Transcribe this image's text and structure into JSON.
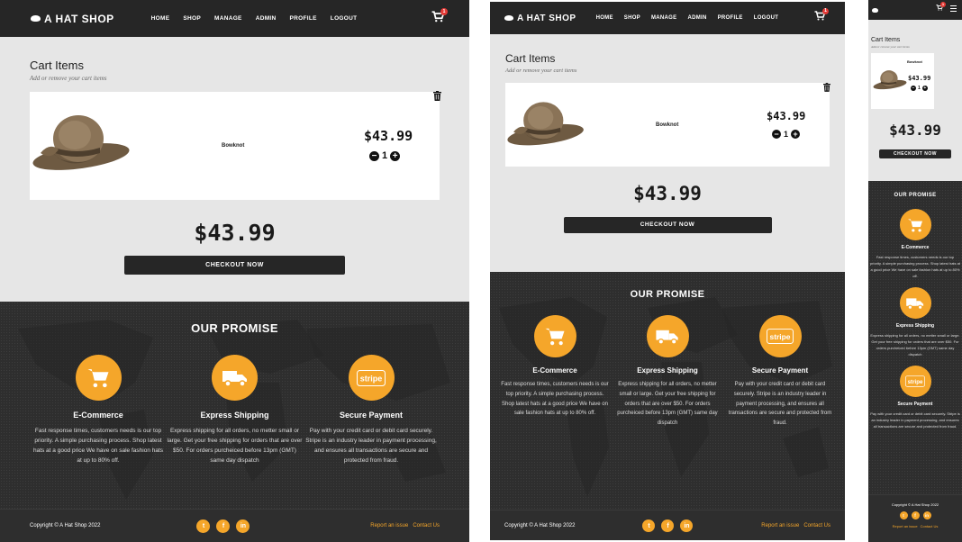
{
  "nav": {
    "brand": "A HAT SHOP",
    "menu": [
      "HOME",
      "SHOP",
      "MANAGE",
      "ADMIN",
      "PROFILE",
      "LOGOUT"
    ],
    "cart_count": "1"
  },
  "cart": {
    "title": "Cart Items",
    "subtitle": "Add or remove your cart items",
    "item": {
      "name": "Bowknot",
      "price": "$43.99",
      "quantity": "1"
    },
    "total": "$43.99",
    "checkout_label": "CHECKOUT NOW"
  },
  "promise": {
    "title": "OUR PROMISE",
    "features": [
      {
        "title": "E-Commerce",
        "icon": "shopping-cart-icon",
        "description": "Fast response times, customers needs is our top priority. A simple purchasing process. Shop latest hats at a good price We have on sale fashion hats at up to 80% off."
      },
      {
        "title": "Express Shipping",
        "icon": "truck-icon",
        "description": "Express shipping for all orders, no metter small or large. Get your free shipping for orders that are over $50. For orders purcheiced before 13pm (GMT) same day dispatch"
      },
      {
        "title": "Secure Payment",
        "icon": "stripe-icon",
        "description": "Pay with your credit card or debit card securely. Stripe is an industry leader in payment processing, and ensures all transactions are secure and protected from fraud."
      }
    ]
  },
  "footer": {
    "copyright": "Copyright © A Hat Shop 2022",
    "socials": [
      "twitter-icon",
      "facebook-icon",
      "linkedin-icon"
    ],
    "social_glyphs": [
      "t",
      "f",
      "in"
    ],
    "report_link": "Report an issue",
    "contact_link": "Contact Us"
  },
  "colors": {
    "accent": "#f5a62a",
    "dark": "#262626",
    "background": "#e6e6e6",
    "badge": "#e53935"
  }
}
